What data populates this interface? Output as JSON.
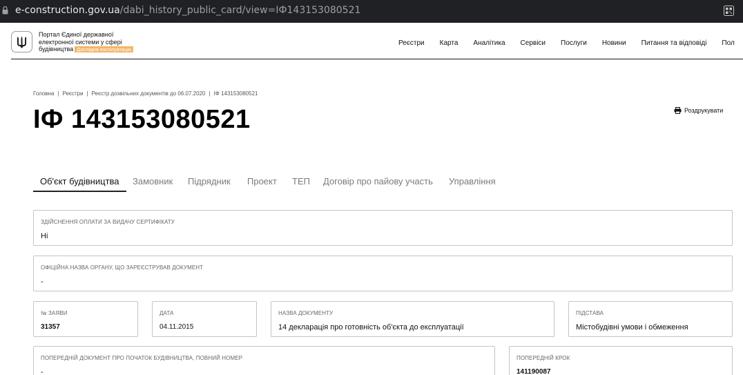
{
  "browser": {
    "url_host": "e-construction.gov.ua",
    "url_path": "/dabi_history_public_card/view=ІФ143153080521"
  },
  "header": {
    "portal_name_lines": [
      "Портал Єдиної державної",
      "електронної системи у сфері",
      "будівництва"
    ],
    "badge": "Дослідна експлуатація",
    "nav": [
      "Реєстри",
      "Карта",
      "Аналітика",
      "Сервіси",
      "Послуги",
      "Новини",
      "Питання та відповіді",
      "Пол"
    ]
  },
  "breadcrumb": [
    "Головна",
    "Реєстри",
    "Реєстр дозвільних документів до 06.07.2020",
    "ІФ 143153080521"
  ],
  "page_title": "ІФ 143153080521",
  "print_label": "Роздрукувати",
  "tabs": [
    "Об'єкт будівництва",
    "Замовник",
    "Підрядник",
    "Проект",
    "ТЕП",
    "Договір про пайову участь",
    "Управління"
  ],
  "fields": {
    "payment": {
      "label": "Здійснення оплати за видачу сертифікату",
      "value": "Ні"
    },
    "organ": {
      "label": "Офіційна назва органу, що зареєстрував документ",
      "value": "-"
    },
    "number": {
      "label": "№ заяви",
      "value": "31357"
    },
    "date": {
      "label": "Дата",
      "value": "04.11.2015"
    },
    "doc_name": {
      "label": "Назва документу",
      "value": "14 декларація про готовність об'єкта до експлуатації"
    },
    "basis": {
      "label": "Підстава",
      "value": "Містобудівні умови і обмеження"
    },
    "prev_doc": {
      "label": "Попередній документ про початок будівництва, повний номер",
      "value": "-"
    },
    "prev_step": {
      "label": "Попередній крок",
      "value": "141190087"
    }
  },
  "icons": {
    "lock": "lock-icon",
    "qr": "qr-code-icon",
    "emblem": "trident-emblem-icon",
    "print": "printer-icon"
  },
  "colors": {
    "badge": "#f2b56b",
    "addressbar": "#202124",
    "tab_active": "#111111",
    "tab_inactive": "#7a7a7a",
    "field_border": "#c4c4c4"
  }
}
